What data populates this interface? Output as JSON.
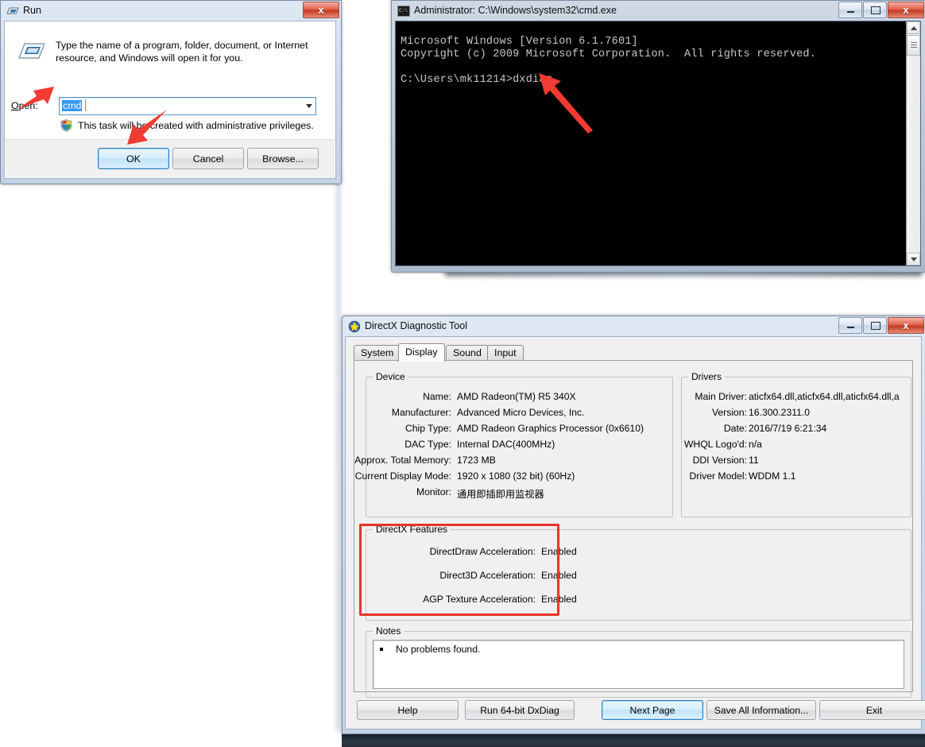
{
  "run_dialog": {
    "title": "Run",
    "icon": "run-window-icon",
    "close_label": "x",
    "description": "Type the name of a program, folder, document, or Internet resource, and Windows will open it for you.",
    "open_label": "Open:",
    "open_value": "cmd",
    "uac_text": "This task will be created with administrative privileges.",
    "buttons": {
      "ok": "OK",
      "cancel": "Cancel",
      "browse": "Browse..."
    }
  },
  "cmd_window": {
    "title": "Administrator: C:\\Windows\\system32\\cmd.exe",
    "minimize_label": "",
    "maximize_label": "",
    "close_label": "x",
    "console_text": "Microsoft Windows [Version 6.1.7601]\nCopyright (c) 2009 Microsoft Corporation.  All rights reserved.\n\nC:\\Users\\mk11214>dxdiag",
    "console_fg": "#c8c8c8",
    "console_bg": "#000000"
  },
  "dxdiag": {
    "title": "DirectX Diagnostic Tool",
    "close_label": "x",
    "tabs": [
      {
        "label": "System",
        "selected": false
      },
      {
        "label": "Display",
        "selected": true
      },
      {
        "label": "Sound",
        "selected": false
      },
      {
        "label": "Input",
        "selected": false
      }
    ],
    "device": {
      "legend": "Device",
      "rows": [
        {
          "key": "Name:",
          "value": "AMD Radeon(TM) R5 340X"
        },
        {
          "key": "Manufacturer:",
          "value": "Advanced Micro Devices, Inc."
        },
        {
          "key": "Chip Type:",
          "value": "AMD Radeon Graphics Processor (0x6610)"
        },
        {
          "key": "DAC Type:",
          "value": "Internal DAC(400MHz)"
        },
        {
          "key": "Approx. Total Memory:",
          "value": "1723 MB"
        },
        {
          "key": "Current Display Mode:",
          "value": "1920 x 1080 (32 bit) (60Hz)"
        },
        {
          "key": "Monitor:",
          "value": "通用即插即用监视器"
        }
      ]
    },
    "drivers": {
      "legend": "Drivers",
      "rows": [
        {
          "key": "Main Driver:",
          "value": "aticfx64.dll,aticfx64.dll,aticfx64.dll,a"
        },
        {
          "key": "Version:",
          "value": "16.300.2311.0"
        },
        {
          "key": "Date:",
          "value": "2016/7/19 6:21:34"
        },
        {
          "key": "WHQL Logo'd:",
          "value": "n/a"
        },
        {
          "key": "DDI Version:",
          "value": "11"
        },
        {
          "key": "Driver Model:",
          "value": "WDDM 1.1"
        }
      ]
    },
    "features": {
      "legend": "DirectX Features",
      "highlight_color": "#e8332a",
      "rows": [
        {
          "key": "DirectDraw Acceleration:",
          "value": "Enabled"
        },
        {
          "key": "Direct3D Acceleration:",
          "value": "Enabled"
        },
        {
          "key": "AGP Texture Acceleration:",
          "value": "Enabled"
        }
      ]
    },
    "notes": {
      "legend": "Notes",
      "text": "No problems found."
    },
    "buttons": [
      {
        "label": "Help",
        "default": false
      },
      {
        "label": "Run 64-bit DxDiag",
        "default": false
      },
      {
        "label": "Next Page",
        "default": true
      },
      {
        "label": "Save All Information...",
        "default": false
      },
      {
        "label": "Exit",
        "default": false
      }
    ]
  },
  "annotations": {
    "arrow_color": "#f23b32",
    "arrows": [
      {
        "name": "arrow-to-open-field"
      },
      {
        "name": "arrow-to-ok-button"
      },
      {
        "name": "arrow-to-dxdiag-command"
      }
    ]
  }
}
